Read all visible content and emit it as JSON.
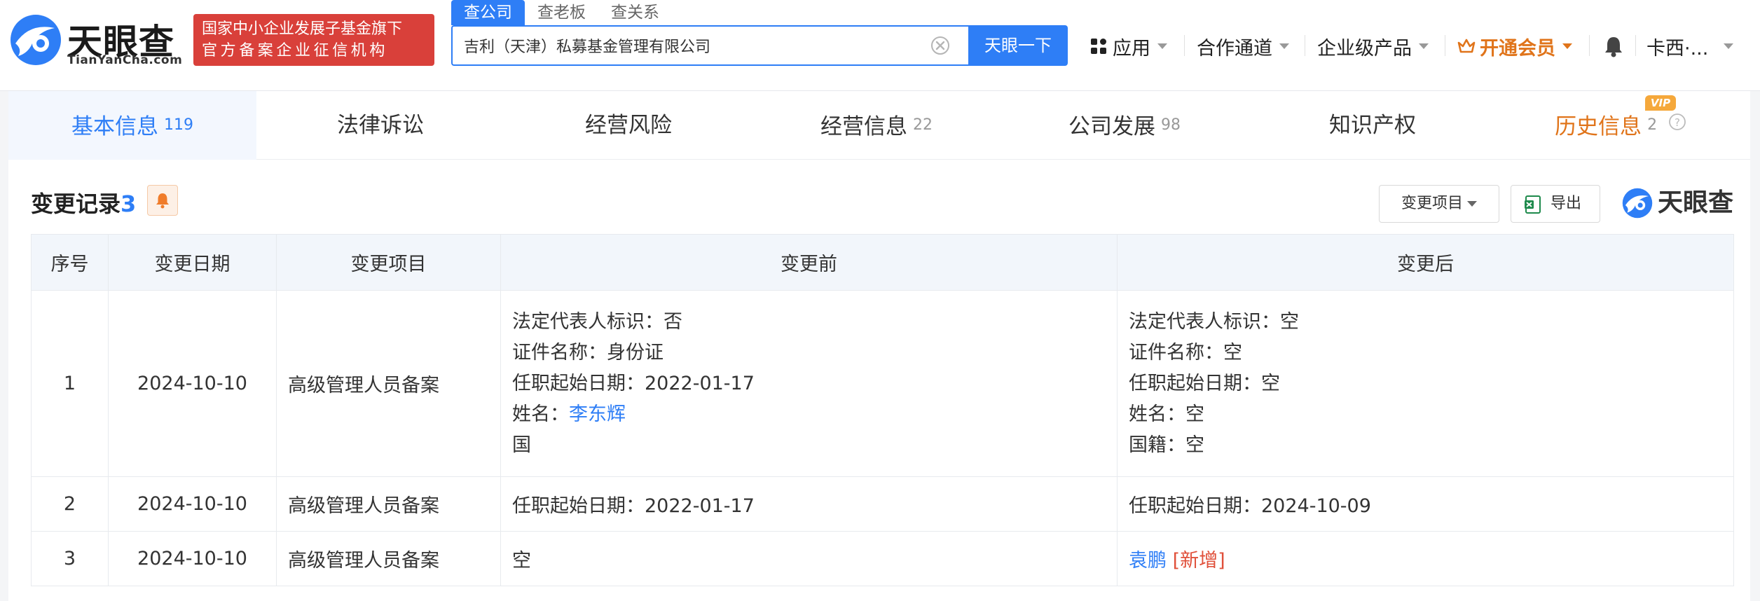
{
  "header": {
    "logo_text": "天眼查",
    "logo_sub": "TianYanCha.com",
    "badge_line1": "国家中小企业发展子基金旗下",
    "badge_line2": "官方备案企业征信机构",
    "search_tabs": [
      "查公司",
      "查老板",
      "查关系"
    ],
    "search_value": "吉利（天津）私募基金管理有限公司",
    "search_button": "天眼一下",
    "nav": {
      "apps": "应用",
      "channels": "合作通道",
      "enterprise": "企业级产品",
      "vip": "开通会员",
      "user": "卡西·..."
    }
  },
  "tabs": [
    {
      "label": "基本信息",
      "count": "119"
    },
    {
      "label": "法律诉讼",
      "count": ""
    },
    {
      "label": "经营风险",
      "count": ""
    },
    {
      "label": "经营信息",
      "count": "22"
    },
    {
      "label": "公司发展",
      "count": "98"
    },
    {
      "label": "知识产权",
      "count": ""
    },
    {
      "label": "历史信息",
      "count": "2"
    }
  ],
  "vip_tag": "VIP",
  "section": {
    "title": "变更记录",
    "count": "3",
    "filter_label": "变更项目",
    "export_label": "导出",
    "watermark": "天眼查"
  },
  "table": {
    "headers": [
      "序号",
      "变更日期",
      "变更项目",
      "变更前",
      "变更后"
    ],
    "rows": [
      {
        "index": "1",
        "date": "2024-10-10",
        "item": "高级管理人员备案",
        "before": {
          "l1": "法定代表人标识：否",
          "l2": "证件名称：身份证",
          "l3": "任职起始日期：2022-01-17",
          "l4_label": "姓名：",
          "l4_link": "李东辉",
          "l5": "国"
        },
        "after": {
          "l1": "法定代表人标识：空",
          "l2": "证件名称：空",
          "l3": "任职起始日期：空",
          "l4": "姓名：空",
          "l5": "国籍：空"
        }
      },
      {
        "index": "2",
        "date": "2024-10-10",
        "item": "高级管理人员备案",
        "before": "任职起始日期：2022-01-17",
        "after": "任职起始日期：2024-10-09"
      },
      {
        "index": "3",
        "date": "2024-10-10",
        "item": "高级管理人员备案",
        "before": "空",
        "after_link": "袁鹏",
        "after_tag": "[新增]"
      }
    ]
  },
  "colors": {
    "primary": "#2e7ef6",
    "badge_red": "#d9403a",
    "vip_orange": "#e0741a",
    "new_tag": "#e0503a"
  }
}
